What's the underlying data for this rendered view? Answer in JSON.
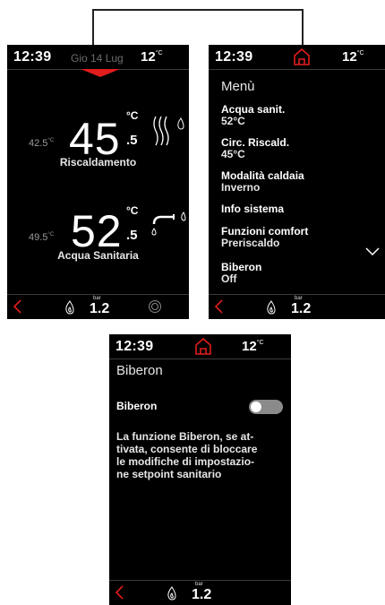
{
  "screen1": {
    "status": {
      "time": "12:39",
      "date": "Gio 14 Lug",
      "ext_temp": "12",
      "ext_unit": "°C"
    },
    "heating": {
      "setpoint": "42.5",
      "setpoint_unit": "°C",
      "value": "45",
      "unit": "°C",
      "decimal": ".5",
      "label": "Riscaldamento"
    },
    "dhw": {
      "setpoint": "49.5",
      "setpoint_unit": "°C",
      "value": "52",
      "unit": "°C",
      "decimal": ".5",
      "label": "Acqua Sanitaria"
    },
    "bottom": {
      "pressure_unit": "bar",
      "pressure": "1.2"
    }
  },
  "screen2": {
    "status": {
      "time": "12:39",
      "ext_temp": "12",
      "ext_unit": "°C"
    },
    "title": "Menù",
    "items": [
      {
        "label": "Acqua sanit.",
        "value": "52°C"
      },
      {
        "label": "Circ. Riscald.",
        "value": "45°C"
      },
      {
        "label": "Modalità caldaia",
        "value": "Inverno"
      },
      {
        "label": "Info sistema",
        "value": ""
      },
      {
        "label": "Funzioni comfort",
        "value": "Preriscaldo"
      },
      {
        "label": "Biberon",
        "value": "Off"
      }
    ],
    "bottom": {
      "pressure_unit": "bar",
      "pressure": "1.2"
    }
  },
  "screen3": {
    "status": {
      "time": "12:39",
      "ext_temp": "12",
      "ext_unit": "°C"
    },
    "title": "Biberon",
    "toggle_label": "Biberon",
    "toggle_on": false,
    "description": "La funzione Biberon, se at-\ntivata, consente di bloccare\nle modifiche di impostazio-\nne setpoint sanitario",
    "bottom": {
      "pressure_unit": "bar",
      "pressure": "1.2"
    }
  },
  "colors": {
    "accent": "#e11d1d",
    "background": "#000000",
    "text": "#ffffff",
    "muted": "#9a9a9a"
  },
  "icons": [
    "home-icon",
    "back-icon",
    "flame-icon",
    "heating-waves-icon",
    "water-tap-icon",
    "pump-icon",
    "chevron-down-icon"
  ]
}
